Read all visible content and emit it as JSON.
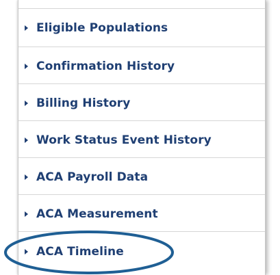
{
  "menu": {
    "items": [
      {
        "label": "Eligible Populations"
      },
      {
        "label": "Confirmation History"
      },
      {
        "label": "Billing History"
      },
      {
        "label": "Work Status Event History"
      },
      {
        "label": "ACA Payroll Data"
      },
      {
        "label": "ACA Measurement"
      },
      {
        "label": "ACA Timeline"
      }
    ],
    "text_color": "#1f3f73"
  },
  "annotation": {
    "color": "#1f5f94",
    "target": "ACA Timeline"
  }
}
